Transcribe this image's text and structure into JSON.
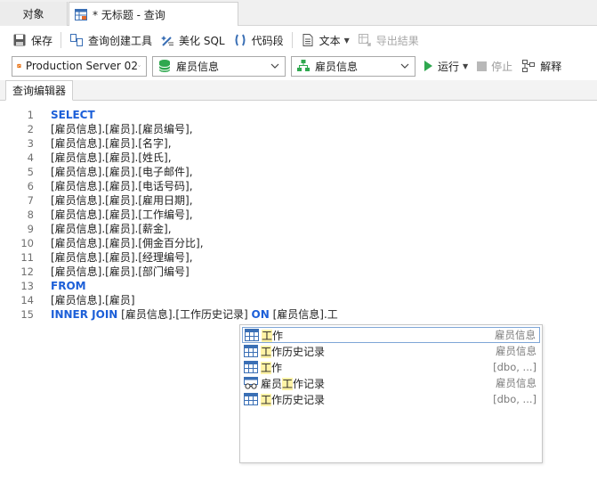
{
  "tabs": {
    "objects_label": "对象",
    "query_label": "* 无标题 - 查询"
  },
  "toolbar": {
    "save": "保存",
    "query_builder": "查询创建工具",
    "beautify_sql": "美化 SQL",
    "code_snippet": "代码段",
    "text": "文本",
    "export_results": "导出結果"
  },
  "toolbar2": {
    "connection": "Production Server 02",
    "database": "雇员信息",
    "schema": "雇员信息",
    "run": "运行",
    "stop": "停止",
    "explain": "解释"
  },
  "editor_tab": "查询编辑器",
  "code_lines": [
    {
      "n": "1",
      "kw": "SELECT",
      "text": ""
    },
    {
      "n": "2",
      "kw": "",
      "text": "[雇员信息].[雇员].[雇员编号],"
    },
    {
      "n": "3",
      "kw": "",
      "text": "[雇员信息].[雇员].[名字],"
    },
    {
      "n": "4",
      "kw": "",
      "text": "[雇员信息].[雇员].[姓氏],"
    },
    {
      "n": "5",
      "kw": "",
      "text": "[雇员信息].[雇员].[电子邮件],"
    },
    {
      "n": "6",
      "kw": "",
      "text": "[雇员信息].[雇员].[电话号码],"
    },
    {
      "n": "7",
      "kw": "",
      "text": "[雇员信息].[雇员].[雇用日期],"
    },
    {
      "n": "8",
      "kw": "",
      "text": "[雇员信息].[雇员].[工作编号],"
    },
    {
      "n": "9",
      "kw": "",
      "text": "[雇员信息].[雇员].[薪金],"
    },
    {
      "n": "10",
      "kw": "",
      "text": "[雇员信息].[雇员].[佣金百分比],"
    },
    {
      "n": "11",
      "kw": "",
      "text": "[雇员信息].[雇员].[经理编号],"
    },
    {
      "n": "12",
      "kw": "",
      "text": "[雇员信息].[雇员].[部门编号]"
    },
    {
      "n": "13",
      "kw": "FROM",
      "text": ""
    },
    {
      "n": "14",
      "kw": "",
      "text": "[雇员信息].[雇员]"
    },
    {
      "n": "15",
      "kw": "INNER JOIN",
      "text": "[雇员信息].[工作历史记录]",
      "kw2": "ON",
      "text2": "[雇员信息].工"
    }
  ],
  "autocomplete": [
    {
      "pre": "",
      "hl": "工",
      "post": "作",
      "schema": "雇员信息",
      "icon": "table-icon"
    },
    {
      "pre": "",
      "hl": "工",
      "post": "作历史记录",
      "schema": "雇员信息",
      "icon": "table-icon"
    },
    {
      "pre": "",
      "hl": "工",
      "post": "作",
      "schema": "[dbo, ...]",
      "icon": "table-icon"
    },
    {
      "pre": "雇员",
      "hl": "工",
      "post": "作记录",
      "schema": "雇员信息",
      "icon": "view-icon"
    },
    {
      "pre": "",
      "hl": "工",
      "post": "作历史记录",
      "schema": "[dbo, ...]",
      "icon": "table-icon"
    }
  ],
  "colors": {
    "keyword": "#1c5fd8",
    "run_green": "#2fa84f",
    "highlight": "#fff3a6"
  }
}
